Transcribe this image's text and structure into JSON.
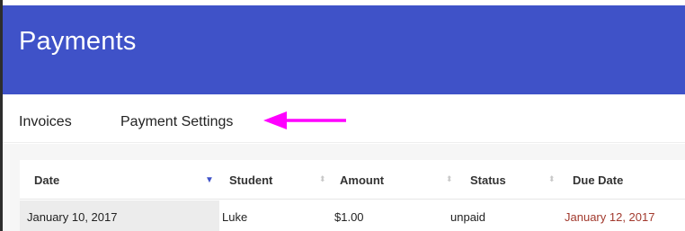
{
  "header": {
    "title": "Payments",
    "color": "#3f52c8"
  },
  "tabs": [
    {
      "label": "Invoices"
    },
    {
      "label": "Payment Settings"
    }
  ],
  "annotation": {
    "arrow_color": "#ff00ff",
    "arrow_icon": "arrow-left-icon"
  },
  "table": {
    "columns": [
      {
        "label": "Date",
        "sorted": true,
        "sort_icon": "sort-down-icon"
      },
      {
        "label": "Student",
        "sort_icon": "sort-both-icon"
      },
      {
        "label": "Amount",
        "sort_icon": "sort-both-icon"
      },
      {
        "label": "Status",
        "sort_icon": "sort-both-icon"
      },
      {
        "label": "Due Date"
      }
    ],
    "rows": [
      {
        "date": "January 10, 2017",
        "student": "Luke",
        "amount": "$1.00",
        "status": "unpaid",
        "due_date": "January 12, 2017"
      }
    ],
    "overdue_color": "#a23a2e"
  }
}
